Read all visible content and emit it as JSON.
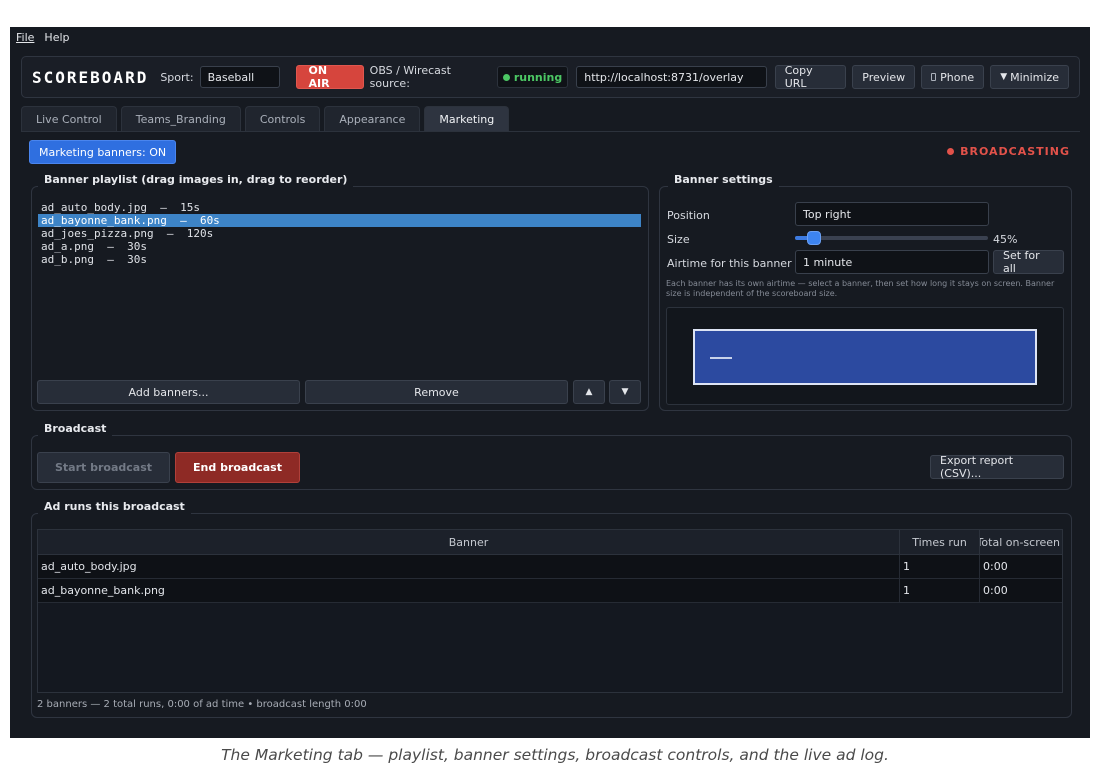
{
  "menubar": {
    "file": "File",
    "help": "Help"
  },
  "topbar": {
    "brand": "SCOREBOARD",
    "sport_label": "Sport:",
    "sport_value": "Baseball",
    "on_air": "ON AIR",
    "source_label": "OBS / Wirecast source:",
    "source_status": "running",
    "url": "http://localhost:8731/overlay",
    "copy_url": "Copy URL",
    "preview": "Preview",
    "phone": "Phone",
    "minimize": "Minimize"
  },
  "tabs": [
    "Live Control",
    "Teams_Branding",
    "Controls",
    "Appearance",
    "Marketing"
  ],
  "active_tab": "Marketing",
  "marketing_toggle": "Marketing banners: ON",
  "status_indicator": "BROADCASTING",
  "playlist": {
    "title": "Banner playlist  (drag images in, drag to reorder)",
    "items": [
      "ad_auto_body.jpg  —  15s",
      "ad_bayonne_bank.png  —  60s",
      "ad_joes_pizza.png  —  120s",
      "ad_a.png  —  30s",
      "ad_b.png  —  30s"
    ],
    "selected_index": 1,
    "add_button": "Add banners...",
    "remove_button": "Remove",
    "up_glyph": "▲",
    "down_glyph": "▼"
  },
  "settings": {
    "title": "Banner settings",
    "position_label": "Position",
    "position_value": "Top right",
    "size_label": "Size",
    "size_percent": 45,
    "size_text": "45%",
    "airtime_label": "Airtime for this banner",
    "airtime_value": "1 minute",
    "set_for_all": "Set for all",
    "hint": "Each banner has its own airtime — select a banner, then set how long it stays on screen. Banner size is independent of the scoreboard size."
  },
  "broadcast": {
    "title": "Broadcast",
    "start": "Start broadcast",
    "end": "End broadcast",
    "export": "Export report (CSV)..."
  },
  "ad_runs": {
    "title": "Ad runs this broadcast",
    "columns": [
      "Banner",
      "Times run",
      "Total on-screen"
    ],
    "rows": [
      {
        "banner": "ad_auto_body.jpg",
        "times": "1",
        "total": "0:00"
      },
      {
        "banner": "ad_bayonne_bank.png",
        "times": "1",
        "total": "0:00"
      }
    ],
    "summary": "2 banners — 2 total runs, 0:00 of ad time • broadcast length 0:00"
  },
  "caption": "The Marketing tab — playlist, banner settings, broadcast controls, and the live ad log.",
  "colors": {
    "on_air": "#d6453d",
    "running": "#4cc764",
    "broadcasting": "#e2524a",
    "toggle": "#2f6fe0",
    "selection": "#3d84c7"
  }
}
